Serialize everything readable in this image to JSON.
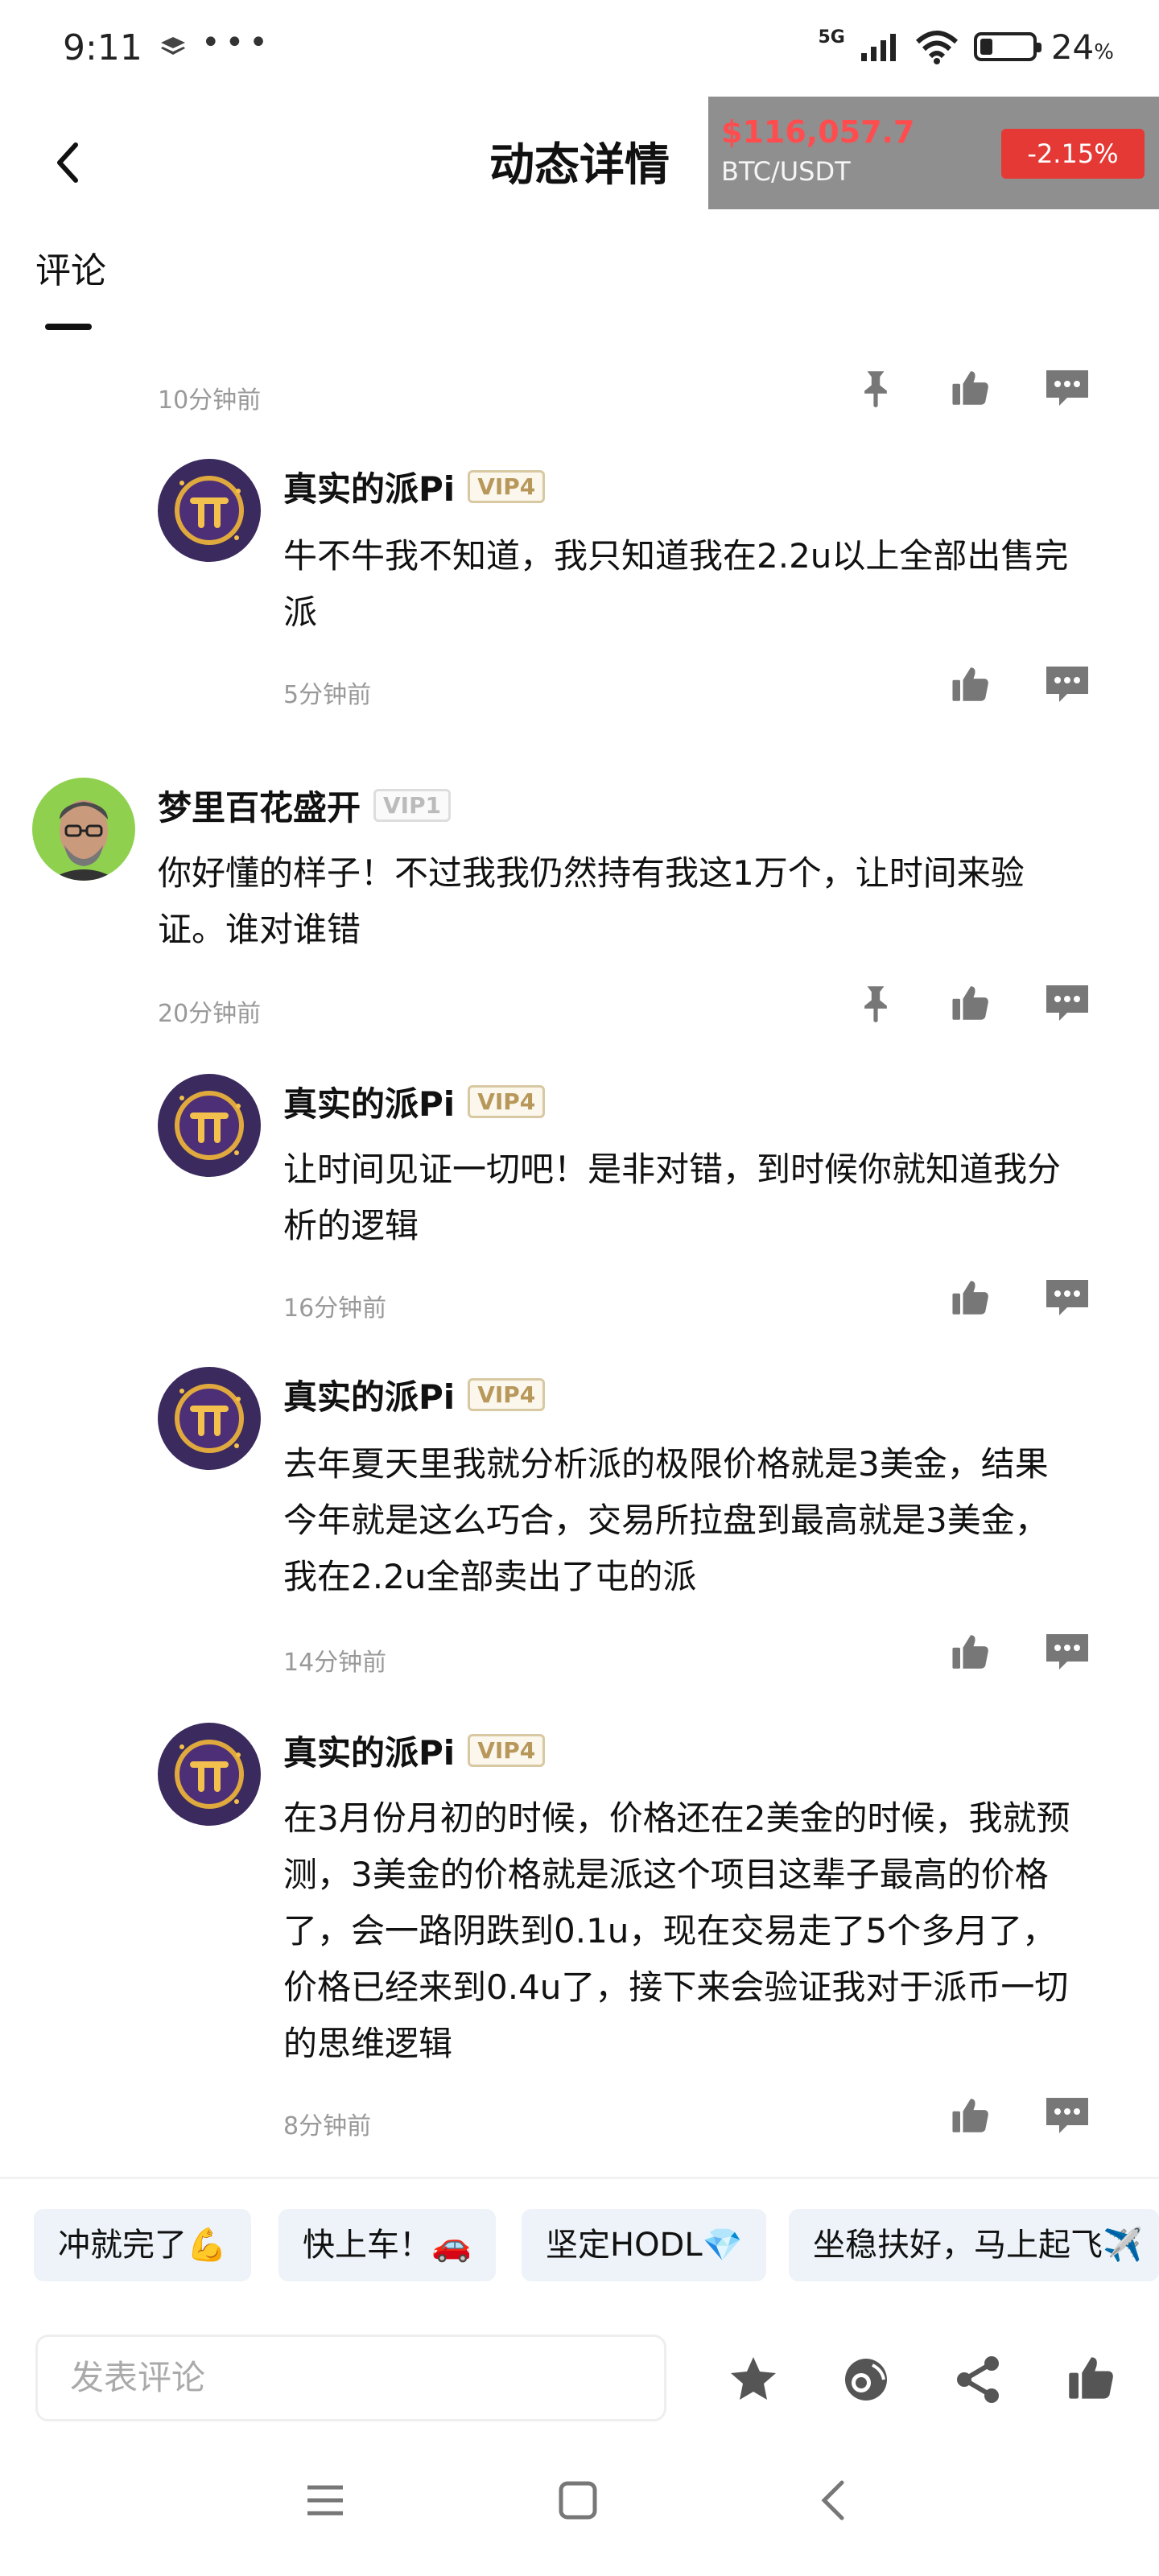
{
  "status_bar": {
    "time": "9:11",
    "dots": "•••",
    "network": "5G",
    "battery_pct": "24",
    "battery_unit": "%",
    "battery_level": 0.24
  },
  "header": {
    "title": "动态详情"
  },
  "ticker": {
    "price": "$116,057.7",
    "pair": "BTC/USDT",
    "change": "-2.15%"
  },
  "tabs": {
    "comments_label": "评论"
  },
  "comments": [
    {
      "time": "10分钟前"
    },
    {
      "user": "真实的派Pi",
      "vip": "VIP4",
      "text_lines": [
        "牛不牛我不知道，我只知道我在2.2u以上全部出售完",
        "派"
      ],
      "time": "5分钟前"
    },
    {
      "user": "梦里百花盛开",
      "vip": "VIP1",
      "text_lines": [
        "你好懂的样子！不过我我仍然持有我这1万个，让时间来验",
        "证。谁对谁错"
      ],
      "time": "20分钟前"
    },
    {
      "user": "真实的派Pi",
      "vip": "VIP4",
      "text_lines": [
        "让时间见证一切吧！是非对错，到时候你就知道我分",
        "析的逻辑"
      ],
      "time": "16分钟前"
    },
    {
      "user": "真实的派Pi",
      "vip": "VIP4",
      "text_lines": [
        "去年夏天里我就分析派的极限价格就是3美金，结果",
        "今年就是这么巧合，交易所拉盘到最高就是3美金，",
        "我在2.2u全部卖出了屯的派"
      ],
      "time": "14分钟前"
    },
    {
      "user": "真实的派Pi",
      "vip": "VIP4",
      "text_lines": [
        "在3月份月初的时候，价格还在2美金的时候，我就预",
        "测，3美金的价格就是派这个项目这辈子最高的价格",
        "了，会一路阴跌到0.1u，现在交易走了5个多月了，",
        "价格已经来到0.4u了，接下来会验证我对于派币一切",
        "的思维逻辑"
      ],
      "time": "8分钟前"
    }
  ],
  "quick_replies": [
    "冲就完了💪",
    "快上车！🚗",
    "坚定HODL💎",
    "坐稳扶好，马上起飞✈️"
  ],
  "comment_input": {
    "placeholder": "发表评论"
  },
  "icons": [
    "back-icon",
    "pin-icon",
    "thumbs-up-icon",
    "comment-icon",
    "star-icon",
    "coin-icon",
    "share-icon",
    "menu-icon",
    "home-icon",
    "nav-back-icon"
  ]
}
